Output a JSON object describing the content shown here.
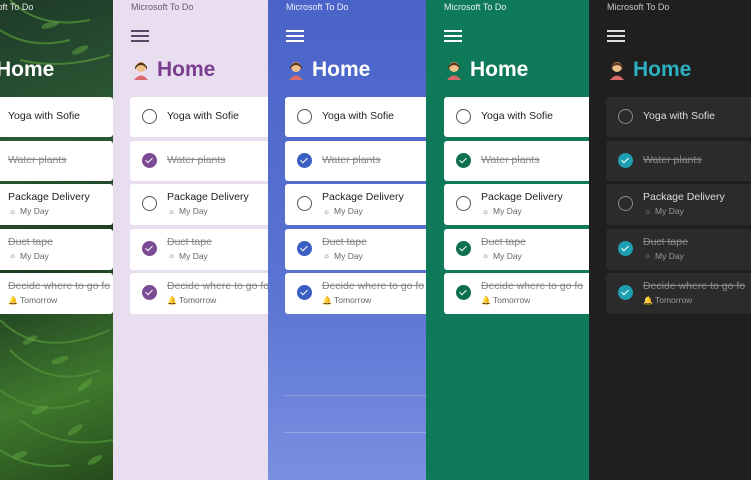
{
  "app": {
    "title": "Microsoft To Do"
  },
  "list": {
    "title": "Home"
  },
  "panels": [
    {
      "app_title": "osoft To Do",
      "heading": "Home"
    },
    {
      "app_title": "Microsoft To Do",
      "heading": "Home",
      "accent": "#7b4b93"
    },
    {
      "app_title": "Microsoft To Do",
      "heading": "Home",
      "accent": "#3a5fc2"
    },
    {
      "app_title": "Microsoft To Do",
      "heading": "Home",
      "accent": "#0e6e50"
    },
    {
      "app_title": "Microsoft To Do",
      "heading": "Home",
      "accent": "#1e9fb0"
    }
  ],
  "tasks": [
    {
      "title": "Yoga with Sofie",
      "completed": false,
      "sub": ""
    },
    {
      "title": "Water plants",
      "completed": true,
      "sub": ""
    },
    {
      "title": "Package Delivery",
      "completed": false,
      "sub": "My Day",
      "sub_icon": "sun-icon"
    },
    {
      "title": "Duct tape",
      "completed": true,
      "sub": "My Day",
      "sub_icon": "sun-icon"
    },
    {
      "title": "Decide where to go fo",
      "completed": true,
      "sub": "Tomorrow",
      "sub_icon": "bell-icon"
    }
  ],
  "task_titles_p1": [
    "Yoga with Sofie",
    "Water plants",
    "Package Delivery",
    "Duct tape",
    "Decide where to go fo"
  ]
}
